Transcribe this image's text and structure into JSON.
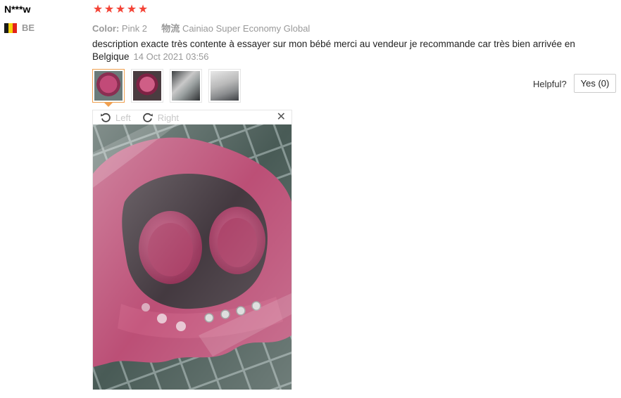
{
  "reviewer": {
    "name": "N***w",
    "country_code": "BE",
    "flag_colors": [
      "#1a1a1a",
      "#f5d20a",
      "#e2231a"
    ]
  },
  "rating": {
    "stars": 5,
    "star_glyph": "★",
    "star_color": "#f44336"
  },
  "attributes": {
    "color_label": "Color:",
    "color_value": "Pink 2",
    "logistics_label": "物流",
    "logistics_value": "Cainiao Super Economy Global"
  },
  "review": {
    "text": "description exacte très contente à essayer sur mon bébé merci au vendeur je recommande car très bien arrivée en Belgique",
    "date": "14 Oct 2021 03:56"
  },
  "thumbnails": [
    {
      "icon": "pink-shower-cap-photo",
      "active": true
    },
    {
      "icon": "pink-cap-top-photo",
      "active": false
    },
    {
      "icon": "packaging-photo",
      "active": false
    },
    {
      "icon": "package-label-photo",
      "active": false
    }
  ],
  "helpful": {
    "label": "Helpful?",
    "yes_label": "Yes (0)"
  },
  "viewer": {
    "rotate_left": "Left",
    "rotate_right": "Right",
    "close_glyph": "✕",
    "image_icon": "pink-baby-shower-cap-photo"
  }
}
